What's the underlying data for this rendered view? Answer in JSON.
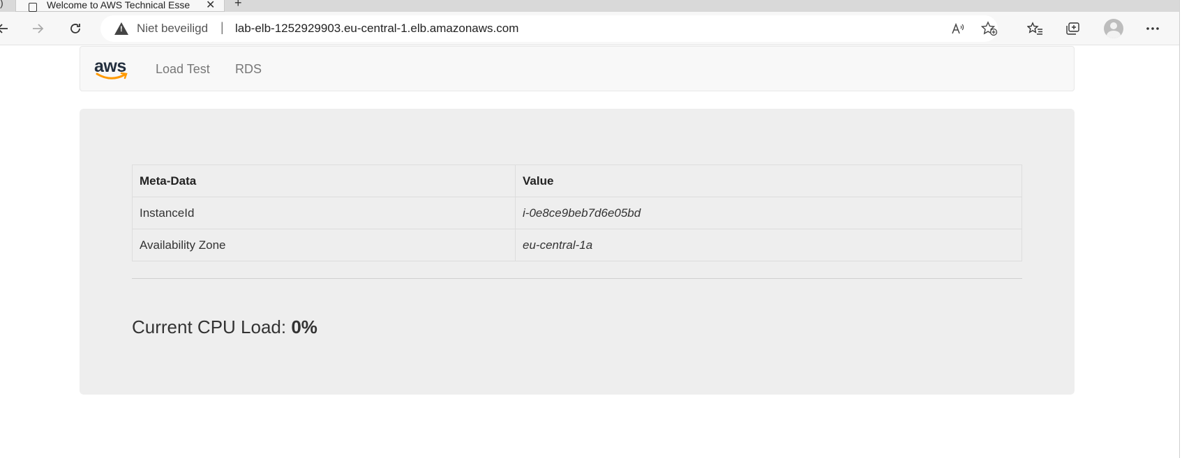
{
  "browser": {
    "tab_title": "Welcome to AWS Technical Esse",
    "tab_close": "✕",
    "new_tab": "+",
    "security_label": "Niet beveiligd",
    "separator": "|",
    "url": "lab-elb-1252929903.eu-central-1.elb.amazonaws.com",
    "icons": {
      "back": "back-arrow-icon",
      "forward": "forward-arrow-icon",
      "reload": "reload-icon",
      "warning": "warning-icon",
      "read_aloud": "read-aloud-icon",
      "add_favorite": "add-favorite-icon",
      "favorites": "favorites-icon",
      "collections": "collections-icon",
      "profile": "profile-icon",
      "more": "more-icon"
    }
  },
  "navbar": {
    "logo_text": "aws",
    "links": [
      "Load Test",
      "RDS"
    ]
  },
  "meta_table": {
    "headers": [
      "Meta-Data",
      "Value"
    ],
    "rows": [
      [
        "InstanceId",
        "i-0e8ce9beb7d6e05bd"
      ],
      [
        "Availability Zone",
        "eu-central-1a"
      ]
    ]
  },
  "cpu": {
    "label": "Current CPU Load: ",
    "value": "0%"
  },
  "colors": {
    "aws_orange": "#ff9900",
    "aws_navy": "#232f3e",
    "jumbotron_bg": "#eeeeee"
  }
}
